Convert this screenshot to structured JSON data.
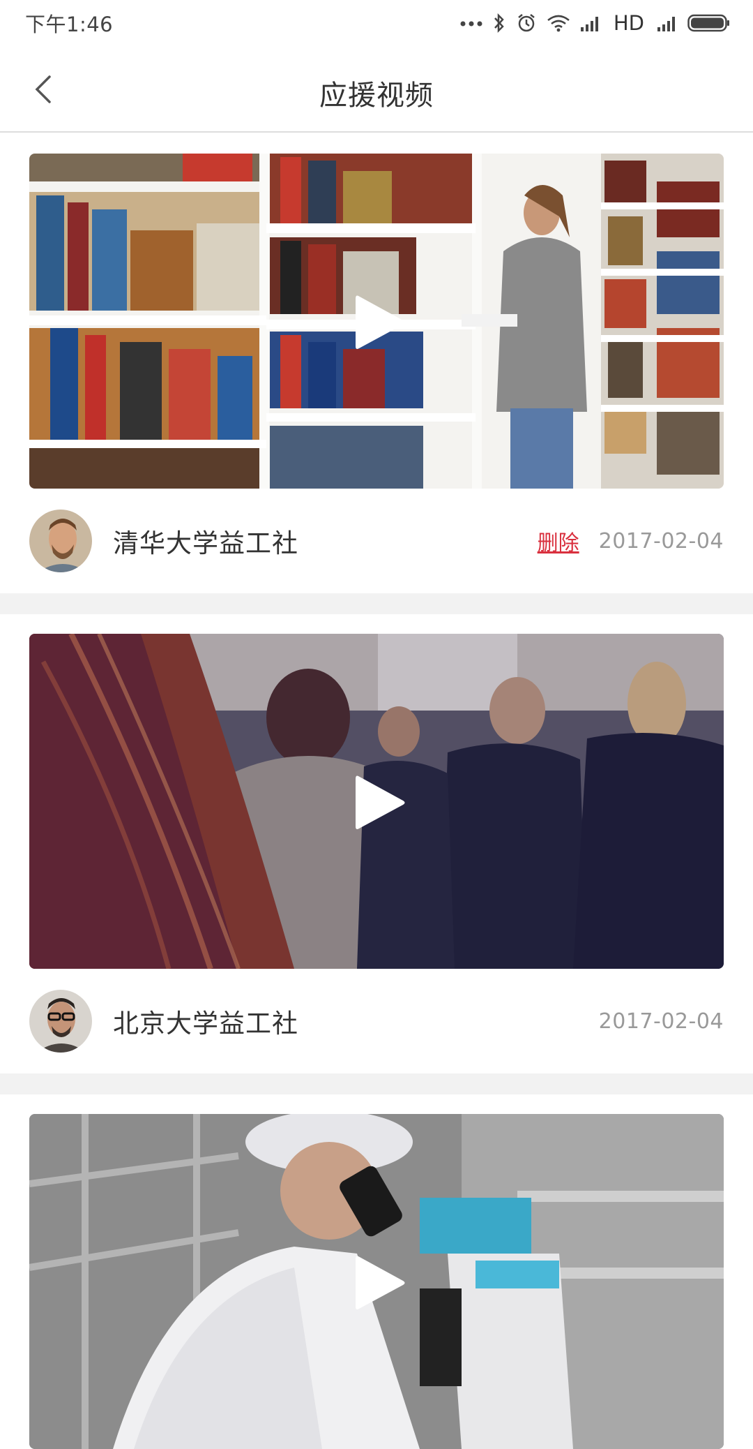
{
  "status_bar": {
    "time": "下午1:46",
    "network_label": "HD",
    "icons": [
      "more-dots-icon",
      "bluetooth-icon",
      "alarm-icon",
      "wifi-icon",
      "signal-icon",
      "signal-icon",
      "battery-icon"
    ]
  },
  "nav": {
    "back_icon": "chevron-left-icon",
    "title": "应援视频"
  },
  "videos": [
    {
      "thumbnail": "library-bookshelves-woman-reading",
      "author": "清华大学益工社",
      "delete_label": "删除",
      "date": "2017-02-04"
    },
    {
      "thumbnail": "crowd-street-people",
      "author": "北京大学益工社",
      "date": "2017-02-04"
    },
    {
      "thumbnail": "lab-scientist-microscope"
    }
  ],
  "colors": {
    "accent_red": "#d9303e",
    "date_gray": "#999999",
    "divider": "#f2f2f2"
  }
}
